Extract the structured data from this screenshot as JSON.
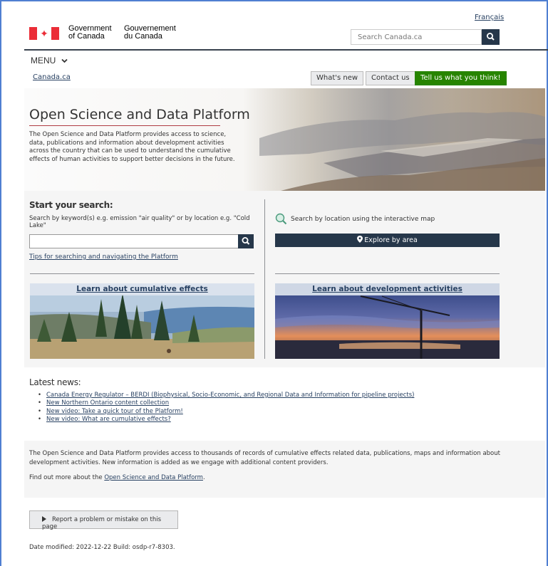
{
  "header": {
    "language_link": "Français",
    "gov_en_line1": "Government",
    "gov_en_line2": "of Canada",
    "gov_fr_line1": "Gouvernement",
    "gov_fr_line2": "du Canada",
    "search_placeholder": "Search Canada.ca",
    "menu_label": "MENU",
    "breadcrumb": "Canada.ca",
    "whats_new": "What's new",
    "contact_us": "Contact us",
    "feedback": "Tell us what you think!"
  },
  "hero": {
    "title": "Open Science and Data Platform",
    "description": "The Open Science and Data Platform provides access to science, data, publications and information about development activities across the country that can be used to understand the cumulative effects of human activities to support better decisions in the future."
  },
  "search": {
    "title": "Start your search:",
    "help": "Search by keyword(s) e.g. emission \"air quality\" or by location e.g. \"Cold Lake\"",
    "input_value": "",
    "tips_link": "Tips for searching and navigating the Platform",
    "map_text": "Search by location using the interactive map",
    "explore_button": "Explore by area"
  },
  "cards": {
    "cumulative": "Learn about cumulative effects",
    "development": "Learn about development activities"
  },
  "news": {
    "title": "Latest news:",
    "items": [
      "Canada Energy Regulator – BERDI (Biophysical, Socio-Economic, and Regional Data and Information for pipeline projects)",
      "New Northern Ontario content collection",
      "New video: Take a quick tour of the Platform!",
      "New video: What are cumulative effects?"
    ]
  },
  "about": {
    "text": "The Open Science and Data Platform provides access to thousands of records of cumulative effects related data, publications, maps and information about development activities. New information is added as we engage with additional content providers.",
    "more_prefix": "Find out more about the ",
    "more_link": "Open Science and Data Platform",
    "more_suffix": "."
  },
  "footer": {
    "report_button": "Report a problem or mistake on this page",
    "date_modified": "Date modified: 2022-12-22 Build: osdp-r7-8303."
  },
  "colors": {
    "brand_dark": "#26374a",
    "link": "#284162",
    "green": "#278400",
    "flag_red": "#eb2d37"
  }
}
